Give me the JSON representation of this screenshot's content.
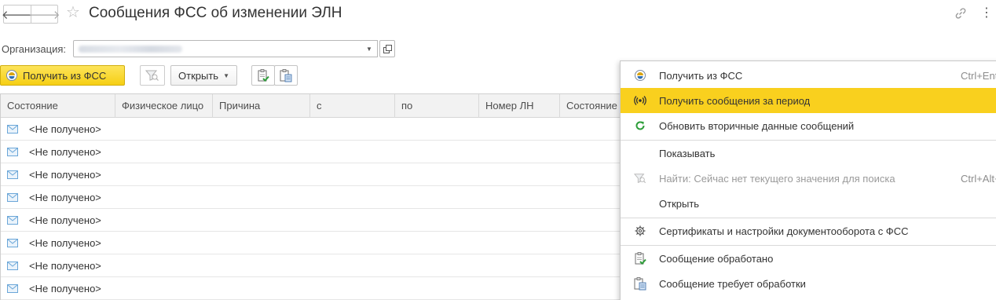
{
  "header": {
    "title": "Сообщения ФСС об изменении ЭЛН",
    "back_glyph": "🡐",
    "forward_glyph": "🡒"
  },
  "organization": {
    "label": "Организация:",
    "value_redacted": true
  },
  "toolbar": {
    "get_from_fss_label": "Получить из ФСС",
    "open_label": "Открыть"
  },
  "table": {
    "columns": [
      "Состояние",
      "Физическое лицо",
      "Причина",
      "с",
      "по",
      "Номер ЛН",
      "Состояние"
    ],
    "rows": [
      {
        "status": "<Не получено>"
      },
      {
        "status": "<Не получено>"
      },
      {
        "status": "<Не получено>"
      },
      {
        "status": "<Не получено>"
      },
      {
        "status": "<Не получено>"
      },
      {
        "status": "<Не получено>"
      },
      {
        "status": "<Не получено>"
      },
      {
        "status": "<Не получено>"
      }
    ]
  },
  "context_menu": {
    "items": [
      {
        "label": "Получить из ФСС",
        "shortcut": "Ctrl+Enter",
        "icon": "fss-icon",
        "enabled": true,
        "highlighted": false
      },
      {
        "label": "Получить сообщения за период",
        "shortcut": "",
        "icon": "signal-icon",
        "enabled": true,
        "highlighted": true
      },
      {
        "label": "Обновить вторичные данные сообщений",
        "shortcut": "",
        "icon": "refresh-icon",
        "enabled": true,
        "highlighted": false
      },
      {
        "label": "Показывать",
        "shortcut": "",
        "icon": "",
        "enabled": true,
        "highlighted": false
      },
      {
        "label": "Найти: Сейчас нет текущего значения для поиска",
        "shortcut": "Ctrl+Alt+F",
        "icon": "search-filter-icon",
        "enabled": false,
        "highlighted": false
      },
      {
        "label": "Открыть",
        "shortcut": "",
        "icon": "",
        "enabled": true,
        "highlighted": false
      },
      {
        "label": "Сертификаты и настройки документооборота с ФСС",
        "shortcut": "",
        "icon": "gear-icon",
        "enabled": true,
        "highlighted": false
      },
      {
        "label": "Сообщение обработано",
        "shortcut": "",
        "icon": "doc-check-icon",
        "enabled": true,
        "highlighted": false
      },
      {
        "label": "Сообщение требует обработки",
        "shortcut": "",
        "icon": "doc-pending-icon",
        "enabled": true,
        "highlighted": false
      }
    ]
  },
  "colors": {
    "accent_yellow": "#f9d01e",
    "refresh_green": "#2e9e3a",
    "envelope_blue": "#6aa6d8"
  }
}
